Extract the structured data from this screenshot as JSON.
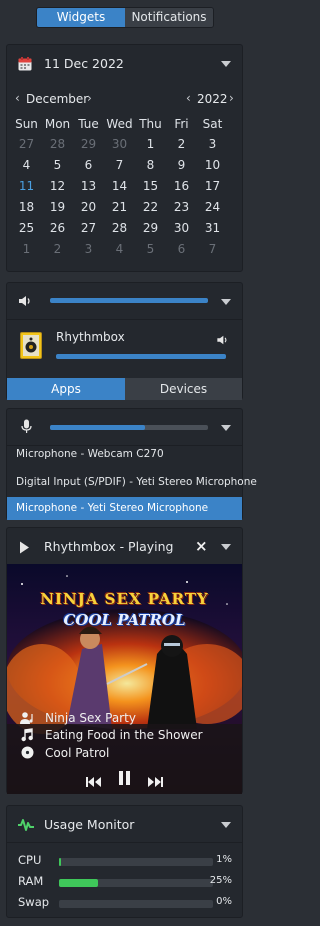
{
  "tabs": {
    "widgets": "Widgets",
    "notifications": "Notifications"
  },
  "calendar": {
    "date_label": "11 Dec 2022",
    "month": "December",
    "year": "2022",
    "weekdays": [
      "Sun",
      "Mon",
      "Tue",
      "Wed",
      "Thu",
      "Fri",
      "Sat"
    ],
    "weeks": [
      [
        "27",
        "28",
        "29",
        "30",
        "1",
        "2",
        "3"
      ],
      [
        "4",
        "5",
        "6",
        "7",
        "8",
        "9",
        "10"
      ],
      [
        "11",
        "12",
        "13",
        "14",
        "15",
        "16",
        "17"
      ],
      [
        "18",
        "19",
        "20",
        "21",
        "22",
        "23",
        "24"
      ],
      [
        "25",
        "26",
        "27",
        "28",
        "29",
        "30",
        "31"
      ],
      [
        "1",
        "2",
        "3",
        "4",
        "5",
        "6",
        "7"
      ]
    ],
    "today": "11"
  },
  "volume": {
    "master_level": 1.0,
    "app_name": "Rhythmbox",
    "app_level": 1.0,
    "tabs": {
      "apps": "Apps",
      "devices": "Devices"
    }
  },
  "microphone": {
    "level": 0.6,
    "sources": [
      "Microphone - Webcam C270",
      "Digital Input (S/PDIF) - Yeti Stereo Microphone",
      "Microphone - Yeti Stereo Microphone"
    ],
    "selected": 2
  },
  "now_playing": {
    "header": "Rhythmbox - Playing",
    "art_title": "NINJA SEX PARTY",
    "art_subtitle": "COOL PATROL",
    "artist": "Ninja Sex Party",
    "track": "Eating Food in the Shower",
    "album": "Cool Patrol"
  },
  "usage": {
    "title": "Usage Monitor",
    "rows": [
      {
        "label": "CPU",
        "value": "1%",
        "fraction": 0.01
      },
      {
        "label": "RAM",
        "value": "25%",
        "fraction": 0.25
      },
      {
        "label": "Swap",
        "value": "0%",
        "fraction": 0.0
      }
    ]
  },
  "colors": {
    "accent": "#3b83c7",
    "usage_bar": "#3fc75a",
    "panel": "#24282e"
  }
}
